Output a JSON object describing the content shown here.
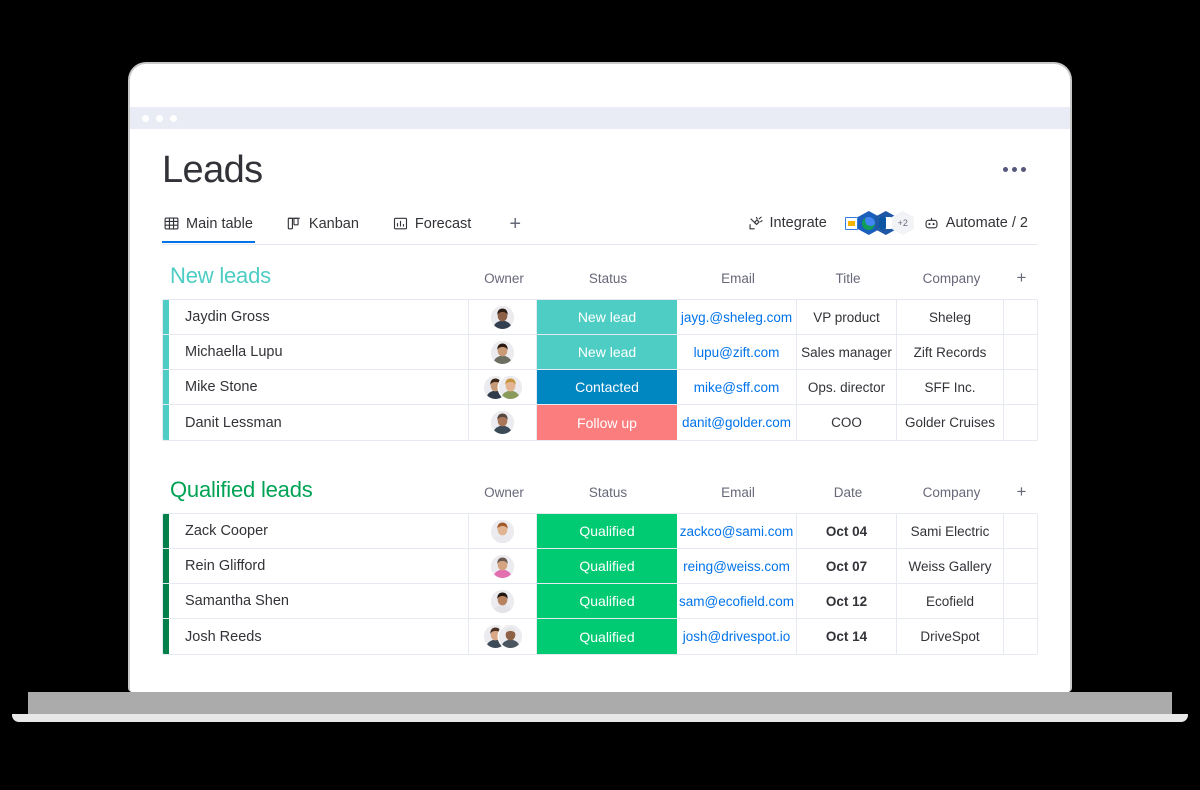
{
  "window": {
    "chrome_dots": [
      "dot-1",
      "dot-2",
      "dot-3"
    ]
  },
  "header": {
    "title": "Leads",
    "kebab_label": "More options"
  },
  "tabs": [
    {
      "label": "Main table",
      "icon": "table-icon",
      "active": true
    },
    {
      "label": "Kanban",
      "icon": "kanban-icon",
      "active": false
    },
    {
      "label": "Forecast",
      "icon": "bar-chart-icon",
      "active": false
    }
  ],
  "tab_add_label": "+",
  "tools": {
    "integrate_label": "Integrate",
    "integrate_icon": "integrate-plug-icon",
    "apps": [
      {
        "name": "google-slides-icon"
      },
      {
        "name": "google-earth-icon"
      },
      {
        "name": "outlook-icon"
      }
    ],
    "apps_overflow": "+2",
    "automate_label": "Automate / 2",
    "automate_icon": "robot-icon"
  },
  "colors": {
    "accent_blue": "#0073ea",
    "teal": "#4ecdc4",
    "blue": "#0086c0",
    "coral": "#fb7d7d",
    "green": "#00ca72",
    "dark_green": "#037f4c",
    "title_teal": "#4ecdc4",
    "title_green": "#00a355",
    "text": "#323338",
    "muted": "#676879",
    "grid": "#e6e9ef"
  },
  "groups": [
    {
      "id": "new-leads",
      "title": "New leads",
      "title_color": "#4ecdc4",
      "bar_color": "#4ecdc4",
      "columns": [
        "Owner",
        "Status",
        "Email",
        "Title",
        "Company"
      ],
      "add_column_label": "+",
      "rows": [
        {
          "name": "Jaydin Gross",
          "owner": {
            "type": "single",
            "skin": "#8d6048",
            "hair": "#2d1d17",
            "shirt": "#33404f"
          },
          "status": {
            "label": "New lead",
            "color": "#4ecdc4"
          },
          "email": "jayg.@sheleg.com",
          "title": "VP product",
          "company": "Sheleg"
        },
        {
          "name": "Michaella Lupu",
          "owner": {
            "type": "single",
            "skin": "#c89a78",
            "hair": "#2b1a12",
            "shirt": "#6b6e61"
          },
          "status": {
            "label": "New lead",
            "color": "#4ecdc4"
          },
          "email": "lupu@zift.com",
          "title": "Sales manager",
          "company": "Zift Records"
        },
        {
          "name": "Mike Stone",
          "owner": {
            "type": "pair",
            "skin": "#c79a77",
            "hair": "#3a2418",
            "shirt": "#2f3b4a",
            "skin2": "#e3b593",
            "hair2": "#c8953f",
            "shirt2": "#8a9a5b"
          },
          "status": {
            "label": "Contacted",
            "color": "#0086c0"
          },
          "email": "mike@sff.com",
          "title": "Ops. director",
          "company": "SFF Inc."
        },
        {
          "name": "Danit Lessman",
          "owner": {
            "type": "single",
            "skin": "#a8775a",
            "hair": "#54483f",
            "shirt": "#3b4a57"
          },
          "status": {
            "label": "Follow up",
            "color": "#fb7d7d"
          },
          "email": "danit@golder.com",
          "title": "COO",
          "company": "Golder Cruises"
        }
      ]
    },
    {
      "id": "qualified-leads",
      "title": "Qualified leads",
      "title_color": "#00a355",
      "bar_color": "#037f4c",
      "columns": [
        "Owner",
        "Status",
        "Email",
        "Date",
        "Company"
      ],
      "add_column_label": "+",
      "rows": [
        {
          "name": "Zack Cooper",
          "owner": {
            "type": "single",
            "skin": "#e0b493",
            "hair": "#a05a2c",
            "shirt": "#e9e9ee"
          },
          "status": {
            "label": "Qualified",
            "color": "#00ca72"
          },
          "email": "zackco@sami.com",
          "date": "Oct 04",
          "company": "Sami Electric"
        },
        {
          "name": "Rein Glifford",
          "owner": {
            "type": "single",
            "skin": "#d3a382",
            "hair": "#6b5a50",
            "shirt": "#e36fb0"
          },
          "status": {
            "label": "Qualified",
            "color": "#00ca72"
          },
          "email": "reing@weiss.com",
          "date": "Oct 07",
          "company": "Weiss Gallery"
        },
        {
          "name": "Samantha Shen",
          "owner": {
            "type": "single",
            "skin": "#b8835f",
            "hair": "#20150f",
            "shirt": "#e3e3e8"
          },
          "status": {
            "label": "Qualified",
            "color": "#00ca72"
          },
          "email": "sam@ecofield.com",
          "date": "Oct 12",
          "company": "Ecofield"
        },
        {
          "name": "Josh Reeds",
          "owner": {
            "type": "pair",
            "skin": "#d9a888",
            "hair": "#4a3124",
            "shirt": "#3d4a57",
            "skin2": "#8e6046",
            "hair2": "#e4e4e4",
            "shirt2": "#4a5560"
          },
          "status": {
            "label": "Qualified",
            "color": "#00ca72"
          },
          "email": "josh@drivespot.io",
          "date": "Oct 14",
          "company": "DriveSpot"
        }
      ]
    }
  ]
}
